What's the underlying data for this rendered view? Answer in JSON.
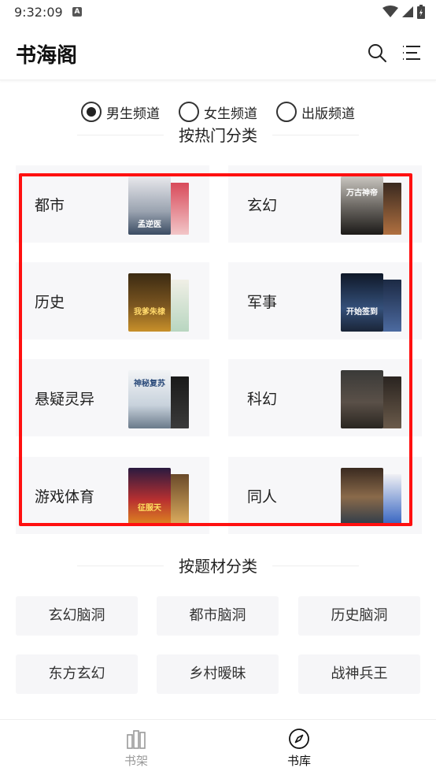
{
  "status_bar": {
    "time": "9:32:09",
    "notification_glyph": "A"
  },
  "app_bar": {
    "title": "书海阁"
  },
  "channels": [
    {
      "label": "男生频道",
      "selected": true
    },
    {
      "label": "女生频道",
      "selected": false
    },
    {
      "label": "出版频道",
      "selected": false
    }
  ],
  "hot_section": {
    "heading": "按热门分类",
    "categories": [
      {
        "label": "都市",
        "cover_text": "孟逆医"
      },
      {
        "label": "玄幻",
        "cover_text": "万古神帝"
      },
      {
        "label": "历史",
        "cover_text": "我爹朱棣"
      },
      {
        "label": "军事",
        "cover_text": "开始签到"
      },
      {
        "label": "悬疑灵异",
        "cover_text": "神秘复苏"
      },
      {
        "label": "科幻",
        "cover_text": ""
      },
      {
        "label": "游戏体育",
        "cover_text": "征服天"
      },
      {
        "label": "同人",
        "cover_text": ""
      }
    ]
  },
  "theme_section": {
    "heading": "按题材分类",
    "tags": [
      "玄幻脑洞",
      "都市脑洞",
      "历史脑洞",
      "东方玄幻",
      "乡村暧昧",
      "战神兵王"
    ]
  },
  "bottom_nav": {
    "items": [
      {
        "label": "书架",
        "icon": "bookshelf-icon",
        "active": false
      },
      {
        "label": "书库",
        "icon": "compass-icon",
        "active": true
      }
    ]
  },
  "colors": {
    "highlight_frame": "#ff1010",
    "card_bg": "#f7f7f9",
    "active_nav": "#111111",
    "inactive_nav": "#999999"
  }
}
